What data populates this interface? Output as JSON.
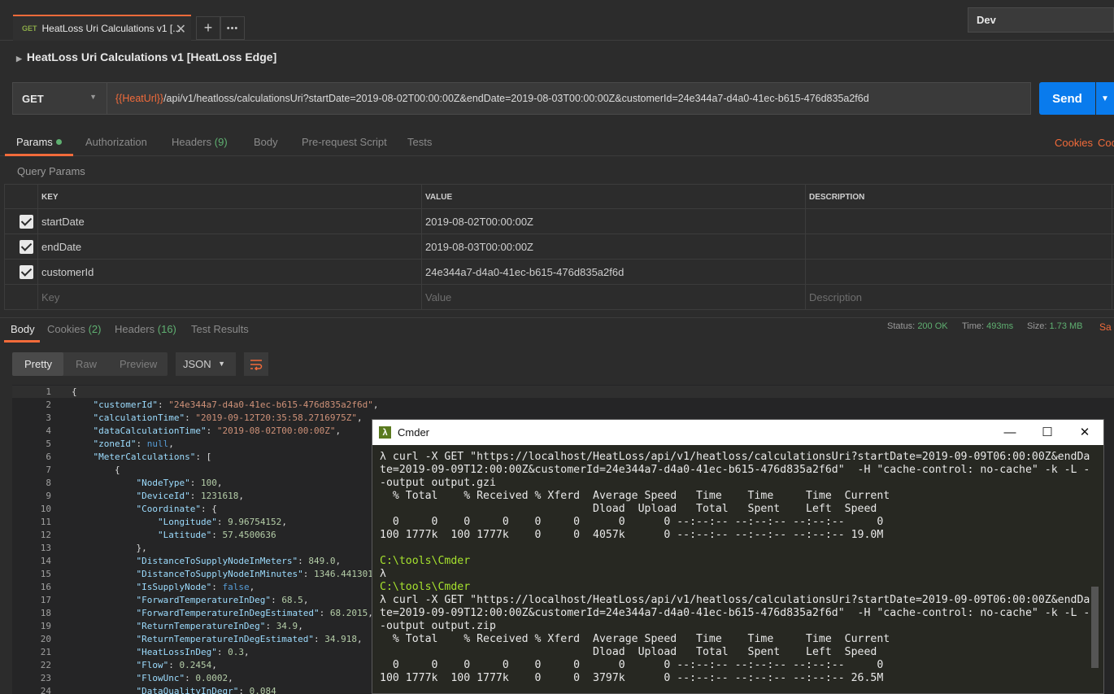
{
  "tab": {
    "method": "GET",
    "title": "HeatLoss Uri Calculations v1 [...",
    "close": "✕",
    "new_tab": "+",
    "more": "•••"
  },
  "environment": "Dev",
  "request": {
    "name": "HeatLoss Uri Calculations v1 [HeatLoss Edge]",
    "method": "GET",
    "url_variable": "{{HeatUrl}}",
    "url_path": "/api/v1/heatloss/calculationsUri?startDate=2019-08-02T00:00:00Z&endDate=2019-08-03T00:00:00Z&customerId=24e344a7-d4a0-41ec-b615-476d835a2f6d",
    "send_label": "Send"
  },
  "request_tabs": {
    "params": "Params",
    "authorization": "Authorization",
    "headers": "Headers",
    "headers_count": "(9)",
    "body": "Body",
    "pre_request": "Pre-request Script",
    "tests": "Tests",
    "cookies": "Cookies",
    "code": "Coc"
  },
  "query_params": {
    "label": "Query Params",
    "columns": [
      "KEY",
      "VALUE",
      "DESCRIPTION"
    ],
    "rows": [
      {
        "key": "startDate",
        "value": "2019-08-02T00:00:00Z",
        "description": ""
      },
      {
        "key": "endDate",
        "value": "2019-08-03T00:00:00Z",
        "description": ""
      },
      {
        "key": "customerId",
        "value": "24e344a7-d4a0-41ec-b615-476d835a2f6d",
        "description": ""
      }
    ],
    "placeholders": {
      "key": "Key",
      "value": "Value",
      "description": "Description"
    }
  },
  "response_tabs": {
    "body": "Body",
    "cookies": "Cookies",
    "cookies_count": "(2)",
    "headers": "Headers",
    "headers_count": "(16)",
    "test_results": "Test Results"
  },
  "response_status": {
    "status_label": "Status:",
    "status": "200 OK",
    "time_label": "Time:",
    "time": "493ms",
    "size_label": "Size:",
    "size": "1.73 MB",
    "save": "Sa"
  },
  "response_toolbar": {
    "pretty": "Pretty",
    "raw": "Raw",
    "preview": "Preview",
    "format": "JSON",
    "wrap_icon": "wrap-icon"
  },
  "json_lines": [
    "{",
    "    \"customerId\": \"24e344a7-d4a0-41ec-b615-476d835a2f6d\",",
    "    \"calculationTime\": \"2019-09-12T20:35:58.2716975Z\",",
    "    \"dataCalculationTime\": \"2019-08-02T00:00:00Z\",",
    "    \"zoneId\": null,",
    "    \"MeterCalculations\": [",
    "        {",
    "            \"NodeType\": 100,",
    "            \"DeviceId\": 1231618,",
    "            \"Coordinate\": {",
    "                \"Longitude\": 9.96754152,",
    "                \"Latitude\": 57.4500636",
    "            },",
    "            \"DistanceToSupplyNodeInMeters\": 849.0,",
    "            \"DistanceToSupplyNodeInMinutes\": 1346.441301",
    "            \"IsSupplyNode\": false,",
    "            \"ForwardTemperatureInDeg\": 68.5,",
    "            \"ForwardTemperatureInDegEstimated\": 68.2015,",
    "            \"ReturnTemperatureInDeg\": 34.9,",
    "            \"ReturnTemperatureInDegEstimated\": 34.918,",
    "            \"HeatLossInDeg\": 0.3,",
    "            \"Flow\": 0.2454,",
    "            \"FlowUnc\": 0.0002,",
    "            \"DataQualityInDegr\": 0.084"
  ],
  "cmder": {
    "title": "Cmder",
    "icon": "λ",
    "minimize": "—",
    "maximize": "☐",
    "close": "✕",
    "lines": [
      {
        "cls": "",
        "text": "λ curl -X GET \"https://localhost/HeatLoss/api/v1/heatloss/calculationsUri?startDate=2019-09-09T06:00:00Z&endDa"
      },
      {
        "cls": "",
        "text": "te=2019-09-09T12:00:00Z&customerId=24e344a7-d4a0-41ec-b615-476d835a2f6d\"  -H \"cache-control: no-cache\" -k -L -"
      },
      {
        "cls": "",
        "text": "-output output.gzi"
      },
      {
        "cls": "",
        "text": "  % Total    % Received % Xferd  Average Speed   Time    Time     Time  Current"
      },
      {
        "cls": "",
        "text": "                                 Dload  Upload   Total   Spent    Left  Speed"
      },
      {
        "cls": "",
        "text": "  0     0    0     0    0     0      0      0 --:--:-- --:--:-- --:--:--     0"
      },
      {
        "cls": "",
        "text": "100 1777k  100 1777k    0     0  4057k      0 --:--:-- --:--:-- --:--:-- 19.0M"
      },
      {
        "cls": "",
        "text": ""
      },
      {
        "cls": "path",
        "text": "C:\\tools\\Cmder"
      },
      {
        "cls": "",
        "text": "λ"
      },
      {
        "cls": "path",
        "text": "C:\\tools\\Cmder"
      },
      {
        "cls": "",
        "text": "λ curl -X GET \"https://localhost/HeatLoss/api/v1/heatloss/calculationsUri?startDate=2019-09-09T06:00:00Z&endDa"
      },
      {
        "cls": "",
        "text": "te=2019-09-09T12:00:00Z&customerId=24e344a7-d4a0-41ec-b615-476d835a2f6d\"  -H \"cache-control: no-cache\" -k -L -"
      },
      {
        "cls": "",
        "text": "-output output.zip"
      },
      {
        "cls": "",
        "text": "  % Total    % Received % Xferd  Average Speed   Time    Time     Time  Current"
      },
      {
        "cls": "",
        "text": "                                 Dload  Upload   Total   Spent    Left  Speed"
      },
      {
        "cls": "",
        "text": "  0     0    0     0    0     0      0      0 --:--:-- --:--:-- --:--:--     0"
      },
      {
        "cls": "",
        "text": "100 1777k  100 1777k    0     0  3797k      0 --:--:-- --:--:-- --:--:-- 26.5M"
      }
    ]
  }
}
